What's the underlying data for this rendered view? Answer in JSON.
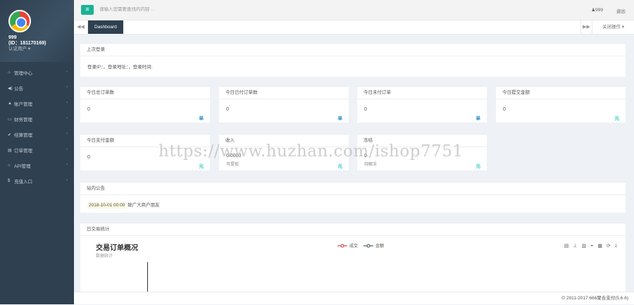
{
  "profile": {
    "name": "999",
    "id": "(ID：181170169)",
    "role": "认证用户 ▾"
  },
  "nav": [
    {
      "icon": "⌂",
      "label": "管理中心"
    },
    {
      "icon": "◀)",
      "label": "公告"
    },
    {
      "icon": "▲",
      "label": "账户管理"
    },
    {
      "icon": "▭",
      "label": "财务管理"
    },
    {
      "icon": "✔",
      "label": "结算管理"
    },
    {
      "icon": "▤",
      "label": "订单管理"
    },
    {
      "icon": "⌂",
      "label": "API管理"
    },
    {
      "icon": "$",
      "label": "充值入口"
    }
  ],
  "topbar": {
    "search_placeholder": "请输入您需要查找的内容 …",
    "user": "♟999",
    "logout": "退出"
  },
  "tabs": {
    "prev": "◀◀",
    "active": "Dashboard",
    "next": "▶▶",
    "close": "关闭操作 ▾"
  },
  "last_login": {
    "title": "上次登录",
    "text": "登录IP：，登录地址：，登录时间:"
  },
  "stats": [
    {
      "title": "今日总订单数",
      "value": "0",
      "unit": "单"
    },
    {
      "title": "今日已付订单数",
      "value": "0",
      "unit": "单"
    },
    {
      "title": "今日未付订单",
      "value": "0",
      "unit": "单"
    },
    {
      "title": "今日提交金额",
      "value": "0",
      "unit": "元"
    },
    {
      "title": "今日支付金额",
      "value": "0",
      "unit": "元"
    },
    {
      "title": "收入",
      "value": "0.0000",
      "sub": "可提现",
      "unit": "元"
    },
    {
      "title": "冻结",
      "value": "0",
      "sub": "待解冻",
      "unit": "元"
    }
  ],
  "notice": {
    "title": "站内公告",
    "date": "2018-10-01 00:00",
    "text": "致广大商户朋友"
  },
  "chart_panel": {
    "title": "日交易统计"
  },
  "chart_data": {
    "type": "line",
    "title": "交易订单概况",
    "subtitle": "数据统计",
    "legend": [
      "成交",
      "金额"
    ],
    "legend_placement": "top-center",
    "toolbox": [
      "▤",
      "⊥",
      "▥",
      "◒",
      "▦",
      "⟳",
      "⤓"
    ],
    "colors": {
      "series1": "#c23531",
      "series2": "#2f4554"
    },
    "series": [
      {
        "name": "成交",
        "values": []
      },
      {
        "name": "金额",
        "values": []
      }
    ]
  },
  "footer": "© 2011-2017 666聚合支付(5.6.6)",
  "watermark": "https://www.huzhan.com/ishop7751"
}
